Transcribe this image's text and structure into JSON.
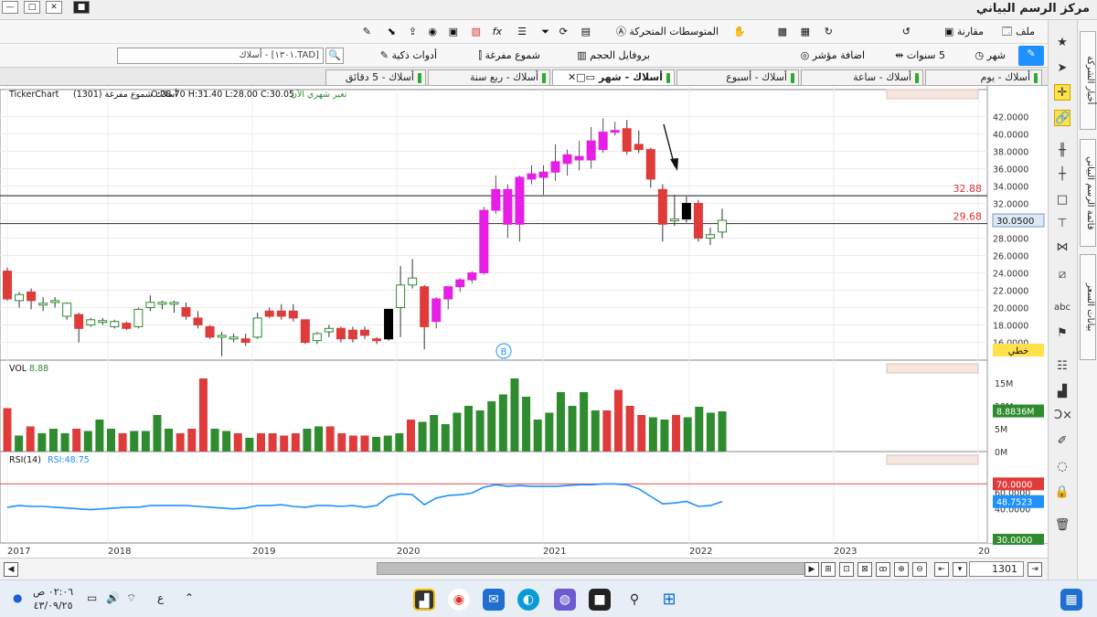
{
  "app": {
    "title": "مركز الرسم البياني"
  },
  "toolbar1": {
    "file": "ملف",
    "compare": "مقارنة",
    "moving_averages": "المتوسطات المتحركة",
    "items_left": [
      "fx-icon",
      "camera-icon",
      "pin-icon"
    ]
  },
  "toolbar2": {
    "period": "شهر",
    "range": "5 سنوات",
    "add_indicator": "اضافة مؤشر",
    "volume_profile": "بروفايل الحجم",
    "hollow_candles": "شموع مفرغة",
    "smart_tools": "أدوات ذكية",
    "search_value": "[TAD.١٣٠١] - أسلاك"
  },
  "tabs": [
    "أسلاك - يوم",
    "أسلاك - ساعة",
    "أسلاك - أسبوع",
    "أسلاك - شهر",
    "أسلاك - ربع سنة",
    "أسلاك - 5 دقائق"
  ],
  "active_tab": 3,
  "chart_header": {
    "source": "TickerChart",
    "symbol_info": "أسلاك شموع مفرغة (1301)",
    "ohlc": "O:28.70  H:31.40  L:28.00  C:30.05",
    "change_note": "تغير شهري الآن"
  },
  "price_panel": {
    "yticks": [
      "42.0000",
      "40.0000",
      "38.0000",
      "36.0000",
      "34.0000",
      "32.0000",
      "30.0000",
      "28.0000",
      "26.0000",
      "24.0000",
      "22.0000",
      "20.0000",
      "18.0000",
      "16.0000"
    ],
    "level_upper": "32.88",
    "level_lower": "29.68",
    "current_price": "30.0500",
    "scale_mode": "خطي",
    "marker": "B"
  },
  "volume_panel": {
    "label": "VOL",
    "value": "8.88",
    "yticks": [
      "15M",
      "10M",
      "5M",
      "0M"
    ],
    "current": "8.8836M"
  },
  "rsi_panel": {
    "label": "RSI(14)",
    "value_label": "RSI:48.75",
    "yticks": [
      "60.0000",
      "40.0000"
    ],
    "upper": "70.0000",
    "lower": "30.0000",
    "current": "48.7523"
  },
  "x_axis": [
    "2017",
    "2018",
    "2019",
    "2020",
    "2021",
    "2022",
    "2023",
    "20"
  ],
  "bottom": {
    "bar_number": "1301"
  },
  "taskbar": {
    "time": "٠٢:٠٦ ص",
    "date": "٤٣/٠٩/٢٥",
    "lang": "ع"
  },
  "colors": {
    "bull": "#2e8b2e",
    "bear": "#e03b3b",
    "strong_bull": "#e61ee6",
    "level_line": "#444444",
    "rsi_line": "#1e90ff",
    "rsi_upper": "#e05050",
    "accent": "#1e90ff",
    "highlight": "#ffe14a"
  },
  "chart_data": {
    "type": "candlestick",
    "ohlc": [
      {
        "o": 21.0,
        "h": 24.6,
        "l": 20.8,
        "c": 24.2,
        "color": "bear"
      },
      {
        "o": 21.5,
        "h": 21.8,
        "l": 20.0,
        "c": 20.8,
        "color": "bull"
      },
      {
        "o": 20.8,
        "h": 22.2,
        "l": 19.8,
        "c": 21.8,
        "color": "bear"
      },
      {
        "o": 20.5,
        "h": 21.2,
        "l": 19.6,
        "c": 20.4,
        "color": "bull"
      },
      {
        "o": 20.8,
        "h": 21.2,
        "l": 20.0,
        "c": 20.8,
        "color": "bull"
      },
      {
        "o": 20.5,
        "h": 20.6,
        "l": 18.6,
        "c": 19.0,
        "color": "bull"
      },
      {
        "o": 19.2,
        "h": 19.4,
        "l": 16.0,
        "c": 17.6,
        "color": "bear"
      },
      {
        "o": 18.0,
        "h": 18.8,
        "l": 17.8,
        "c": 18.6,
        "color": "bull"
      },
      {
        "o": 18.5,
        "h": 18.8,
        "l": 18.0,
        "c": 18.5,
        "color": "bull"
      },
      {
        "o": 17.8,
        "h": 18.6,
        "l": 17.6,
        "c": 18.4,
        "color": "bull"
      },
      {
        "o": 18.2,
        "h": 18.4,
        "l": 17.4,
        "c": 17.6,
        "color": "bear"
      },
      {
        "o": 17.8,
        "h": 20.0,
        "l": 17.6,
        "c": 19.8,
        "color": "bull"
      },
      {
        "o": 20.0,
        "h": 21.4,
        "l": 19.6,
        "c": 20.6,
        "color": "bull"
      },
      {
        "o": 20.4,
        "h": 20.8,
        "l": 19.8,
        "c": 20.6,
        "color": "bull"
      },
      {
        "o": 20.6,
        "h": 20.8,
        "l": 19.4,
        "c": 20.4,
        "color": "bull"
      },
      {
        "o": 20.0,
        "h": 20.6,
        "l": 18.6,
        "c": 19.0,
        "color": "bear"
      },
      {
        "o": 18.8,
        "h": 19.6,
        "l": 17.6,
        "c": 18.0,
        "color": "bear"
      },
      {
        "o": 17.8,
        "h": 18.0,
        "l": 16.4,
        "c": 16.6,
        "color": "bear"
      },
      {
        "o": 16.8,
        "h": 17.2,
        "l": 14.4,
        "c": 16.6,
        "color": "bull"
      },
      {
        "o": 16.6,
        "h": 17.0,
        "l": 16.0,
        "c": 16.6,
        "color": "bull"
      },
      {
        "o": 16.4,
        "h": 17.0,
        "l": 15.6,
        "c": 16.0,
        "color": "bear"
      },
      {
        "o": 16.6,
        "h": 19.4,
        "l": 16.4,
        "c": 18.8,
        "color": "bull"
      },
      {
        "o": 19.6,
        "h": 20.0,
        "l": 18.8,
        "c": 19.0,
        "color": "bear"
      },
      {
        "o": 19.0,
        "h": 20.4,
        "l": 18.6,
        "c": 19.6,
        "color": "bear"
      },
      {
        "o": 19.6,
        "h": 20.4,
        "l": 18.4,
        "c": 18.8,
        "color": "bear"
      },
      {
        "o": 18.6,
        "h": 18.6,
        "l": 15.8,
        "c": 16.0,
        "color": "bear"
      },
      {
        "o": 16.2,
        "h": 17.2,
        "l": 15.8,
        "c": 17.0,
        "color": "bull"
      },
      {
        "o": 17.2,
        "h": 18.0,
        "l": 16.6,
        "c": 17.6,
        "color": "bull"
      },
      {
        "o": 17.6,
        "h": 17.8,
        "l": 16.0,
        "c": 16.4,
        "color": "bear"
      },
      {
        "o": 16.4,
        "h": 17.8,
        "l": 16.0,
        "c": 17.4,
        "color": "bear"
      },
      {
        "o": 17.4,
        "h": 17.8,
        "l": 16.4,
        "c": 16.8,
        "color": "bear"
      },
      {
        "o": 16.4,
        "h": 16.6,
        "l": 15.8,
        "c": 16.2,
        "color": "bear"
      },
      {
        "o": 16.4,
        "h": 19.8,
        "l": 16.2,
        "c": 19.8,
        "color": "black"
      },
      {
        "o": 20.0,
        "h": 24.8,
        "l": 16.6,
        "c": 22.6,
        "color": "bull"
      },
      {
        "o": 22.6,
        "h": 25.6,
        "l": 22.2,
        "c": 23.4,
        "color": "bull"
      },
      {
        "o": 22.4,
        "h": 22.6,
        "l": 15.2,
        "c": 17.8,
        "color": "bear"
      },
      {
        "o": 18.4,
        "h": 21.2,
        "l": 17.6,
        "c": 21.0,
        "color": "strong_bull"
      },
      {
        "o": 21.0,
        "h": 22.0,
        "l": 19.8,
        "c": 22.4,
        "color": "strong_bull"
      },
      {
        "o": 22.4,
        "h": 23.4,
        "l": 21.8,
        "c": 23.2,
        "color": "strong_bull"
      },
      {
        "o": 23.2,
        "h": 24.2,
        "l": 22.8,
        "c": 24.0,
        "color": "strong_bull"
      },
      {
        "o": 24.0,
        "h": 31.6,
        "l": 23.8,
        "c": 31.2,
        "color": "strong_bull"
      },
      {
        "o": 31.2,
        "h": 35.2,
        "l": 30.8,
        "c": 33.6,
        "color": "strong_bull"
      },
      {
        "o": 33.6,
        "h": 34.2,
        "l": 28.0,
        "c": 29.6,
        "color": "strong_bull"
      },
      {
        "o": 29.6,
        "h": 35.2,
        "l": 27.6,
        "c": 35.0,
        "color": "strong_bull"
      },
      {
        "o": 34.8,
        "h": 36.4,
        "l": 34.2,
        "c": 35.4,
        "color": "strong_bull"
      },
      {
        "o": 35.0,
        "h": 36.4,
        "l": 33.0,
        "c": 35.6,
        "color": "strong_bull"
      },
      {
        "o": 35.6,
        "h": 38.8,
        "l": 34.6,
        "c": 36.8,
        "color": "strong_bull"
      },
      {
        "o": 36.6,
        "h": 38.2,
        "l": 35.2,
        "c": 37.6,
        "color": "strong_bull"
      },
      {
        "o": 37.4,
        "h": 39.2,
        "l": 35.8,
        "c": 37.0,
        "color": "strong_bull"
      },
      {
        "o": 37.0,
        "h": 40.8,
        "l": 36.0,
        "c": 39.2,
        "color": "strong_bull"
      },
      {
        "o": 38.2,
        "h": 41.8,
        "l": 37.8,
        "c": 40.2,
        "color": "strong_bull"
      },
      {
        "o": 40.2,
        "h": 41.4,
        "l": 39.8,
        "c": 40.4,
        "color": "strong_bull"
      },
      {
        "o": 40.6,
        "h": 41.6,
        "l": 37.6,
        "c": 38.0,
        "color": "bear"
      },
      {
        "o": 38.8,
        "h": 40.4,
        "l": 37.8,
        "c": 38.2,
        "color": "bear"
      },
      {
        "o": 38.2,
        "h": 38.4,
        "l": 33.8,
        "c": 34.8,
        "color": "bear"
      },
      {
        "o": 33.6,
        "h": 34.2,
        "l": 27.6,
        "c": 29.6,
        "color": "bear"
      },
      {
        "o": 30.0,
        "h": 33.0,
        "l": 29.4,
        "c": 30.2,
        "color": "bull"
      },
      {
        "o": 32.0,
        "h": 32.8,
        "l": 29.8,
        "c": 30.2,
        "color": "black"
      },
      {
        "o": 32.0,
        "h": 32.4,
        "l": 27.6,
        "c": 28.0,
        "color": "bear"
      },
      {
        "o": 28.0,
        "h": 29.2,
        "l": 27.2,
        "c": 28.4,
        "color": "bull"
      },
      {
        "o": 28.7,
        "h": 31.4,
        "l": 28.0,
        "c": 30.05,
        "color": "bull"
      }
    ],
    "volume_millions": [
      9.5,
      3.5,
      5.5,
      4,
      5,
      4,
      5,
      4.5,
      7,
      5,
      4,
      4.5,
      4.5,
      8,
      5,
      4,
      5,
      16,
      5,
      4.5,
      4,
      3,
      4,
      4,
      3.5,
      4,
      5,
      5.5,
      5.5,
      4,
      3.5,
      3.5,
      3.2,
      3.5,
      4,
      7,
      6.5,
      8,
      6,
      8.5,
      10,
      9,
      11,
      12.5,
      16,
      12,
      7,
      8.5,
      13,
      10,
      13,
      9,
      9,
      13.5,
      10,
      8,
      7.5,
      7,
      8,
      7.5,
      9.8,
      8.5,
      8.8
    ],
    "rsi": [
      42,
      44,
      43,
      43,
      42,
      41,
      40,
      39,
      40,
      41,
      42,
      42,
      44,
      44,
      44,
      44,
      43,
      42,
      41,
      40,
      41,
      44,
      44,
      45,
      43,
      42,
      44,
      44,
      43,
      44,
      42,
      44,
      55,
      58,
      57,
      45,
      53,
      56,
      57,
      59,
      66,
      69,
      67,
      68,
      67,
      67,
      67,
      68,
      69,
      69,
      70,
      70,
      69,
      64,
      55,
      46,
      47,
      49,
      43,
      44,
      48.75
    ],
    "levels": [
      32.88,
      29.68
    ],
    "ylim": [
      15,
      43
    ],
    "rsi_bands": [
      70,
      30
    ],
    "x_ticks": [
      "2017",
      "2018",
      "2019",
      "2020",
      "2021",
      "2022",
      "2023",
      "20"
    ]
  }
}
